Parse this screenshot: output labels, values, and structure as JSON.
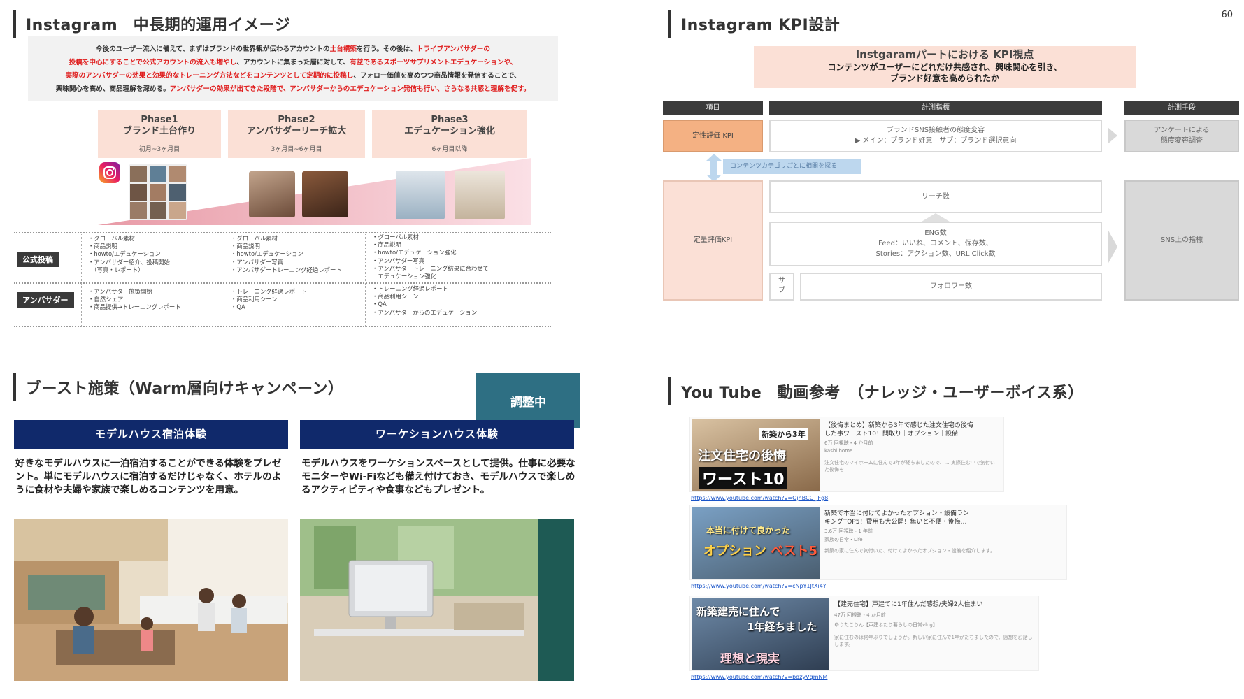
{
  "page_number": "60",
  "instagram_plan": {
    "heading": "Instagram　中長期的運用イメージ",
    "intro_lines": [
      [
        {
          "t": "今後のユーザー流入に備えて、まずはブランドの世界観が伝わるアカウントの",
          "r": false
        },
        {
          "t": "土台構築",
          "r": true
        },
        {
          "t": "を行う。その後は、",
          "r": false
        },
        {
          "t": "トライブアンバサダーの",
          "r": true
        }
      ],
      [
        {
          "t": "投稿を中心にすることで公式アカウントの流入も増やし",
          "r": true
        },
        {
          "t": "、アカウントに集まった層に対して、",
          "r": false
        },
        {
          "t": "有益であるスポーツサプリメントエデュケーションや、",
          "r": true
        }
      ],
      [
        {
          "t": "実際のアンバサダーの効果と効果的なトレーニング方法などをコンテンツとして定期的に投稿し",
          "r": true
        },
        {
          "t": "、フォロー価値を高めつつ商品情報を発信することで、",
          "r": false
        }
      ],
      [
        {
          "t": "興味関心を高め、商品理解を深める。",
          "r": false
        },
        {
          "t": "アンバサダーの効果が出てきた段階で、アンバサダーからのエデュケーション発信も行い、さらなる共感と理解を促す。",
          "r": true
        }
      ]
    ],
    "phases": [
      {
        "name": "Phase1",
        "title": "ブランド土台作り",
        "period": "初月~3ヶ月目"
      },
      {
        "name": "Phase2",
        "title": "アンバサダーリーチ拡大",
        "period": "3ヶ月目~6ヶ月目"
      },
      {
        "name": "Phase3",
        "title": "エデュケーション強化",
        "period": "6ヶ月目以降"
      }
    ],
    "rows": [
      {
        "label": "公式投稿",
        "cells": [
          "・グローバル素材\n・商品説明\n・howto/エデュケーション\n・アンバサダー紹介、投稿開始\n　（写真・レポート）",
          "・グローバル素材\n・商品説明\n・howto/エデュケーション\n・アンバサダー写真\n・アンバサダートレーニング経過レポート",
          "・グローバル素材\n・商品説明\n・howto/エデュケーション強化\n・アンバサダー写真\n・アンバサダートレーニング結果に合わせて\n　エデュケーション強化"
        ]
      },
      {
        "label": "アンバサダー",
        "cells": [
          "・アンバサダー施策開始\n・自然シェア\n・商品提供→トレーニングレポート",
          "・トレーニング経過レポート\n・商品利用シーン\n・QA",
          "・トレーニング経過レポート\n・商品利用シーン\n・QA\n・アンバサダーからのエデュケーション"
        ]
      }
    ],
    "colors": {
      "red": "#e02020",
      "peach": "#fbe0d6",
      "pink": "#f3c5cc",
      "dark": "#3a3a3a"
    }
  },
  "kpi": {
    "heading": "Instagram KPI設計",
    "box_title": "Instgaramパートにおける KPI視点",
    "box_sub1": "コンテンツがユーザーにどれだけ共感され、興味関心を引き、",
    "box_sub2": "ブランド好意を高められたか",
    "headers": {
      "item": "項目",
      "metric": "計測指標",
      "method": "計測手段"
    },
    "qualitative_label": "定性評価 KPI",
    "qualitative_metric_1": "ブランドSNS接触者の態度変容",
    "qualitative_metric_2": "▶ メイン：ブランド好意　サブ：ブランド選択意向",
    "qualitative_method": "アンケートによる\n態度変容調査",
    "link_tag": "コンテンツカテゴリごとに相関を探る",
    "quantitative_label": "定量評価KPI",
    "reach": "リーチ数",
    "eng_1": "ENG数",
    "eng_2": "Feed：いいね、コメント、保存数、",
    "eng_3": "Stories：アクション数、URL Click数",
    "sub_label": "サ\nブ",
    "followers": "フォロワー数",
    "quantitative_method": "SNS上の指標"
  },
  "boost": {
    "heading": "ブースト施策（Warm層向けキャンペーン）",
    "badge": "調整中",
    "campaigns": [
      {
        "title": "モデルハウス宿泊体験",
        "desc": "好きなモデルハウスに一泊宿泊することができる体験をプレゼント。単にモデルハウスに宿泊するだけじゃなく、ホテルのように食材や夫婦や家族で楽しめるコンテンツを用意。"
      },
      {
        "title": "ワーケションハウス体験",
        "desc": "モデルハウスをワーケションスペースとして提供。仕事に必要なモニターやWi-Fiなども備え付けておき、モデルハウスで楽しめるアクティビティや食事などもプレゼント。"
      }
    ],
    "colors": {
      "navy": "#10296b",
      "teal": "#2e6f83"
    }
  },
  "youtube": {
    "heading": "You Tube　動画参考　（ナレッジ・ユーザーボイス系）",
    "videos": [
      {
        "title_1": "【後悔まとめ】新築から3年で感じた注文住宅の後悔",
        "title_2": "した事ワースト10！間取り｜オプション｜設備｜",
        "meta": "6万 回視聴・4 か月前",
        "channel": "kashi home",
        "snippet": "注文住宅のマイホームに住んで3年が経ちましたので、… 実際住む中で気付いた後悔を",
        "thumb_1": "新築から3年",
        "thumb_2": "注文住宅の後悔",
        "thumb_3": "ワースト10",
        "url": "https://www.youtube.com/watch?v=QjhBCC_jFg8"
      },
      {
        "title_1": "新築で本当に付けてよかったオプション・設備ラン",
        "title_2": "キングTOP5！費用も大公開！無いと不便・後悔…",
        "meta": "3.6万 回視聴・1 年前",
        "channel": "家族の日常・Life",
        "snippet": "新築の家に住んで気付いた、付けてよかったオプション・設備を紹介します。",
        "thumb_1": "本当に付けて良かった",
        "thumb_2": "オプション",
        "thumb_3": "ベスト5",
        "url": "https://www.youtube.com/watch?v=cNpY1JtXi4Y"
      },
      {
        "title_1": "【建売住宅】戸建てに1年住んだ感想/夫婦2人住まい",
        "title_2": "",
        "meta": "47万 回視聴・4 か月前",
        "channel": "ゆうたこりん【戸建ふたり暮らしの日常vlog】",
        "snippet": "家に住むのは何年ぶりでしょうか。新しい家に住んで1年がたちましたので、感想をお話しします。",
        "thumb_1": "新築建売に住んで",
        "thumb_2": "1年経ちました",
        "thumb_3": "理想と現実",
        "url": "https://www.youtube.com/watch?v=bdzyVqmNM"
      }
    ]
  }
}
